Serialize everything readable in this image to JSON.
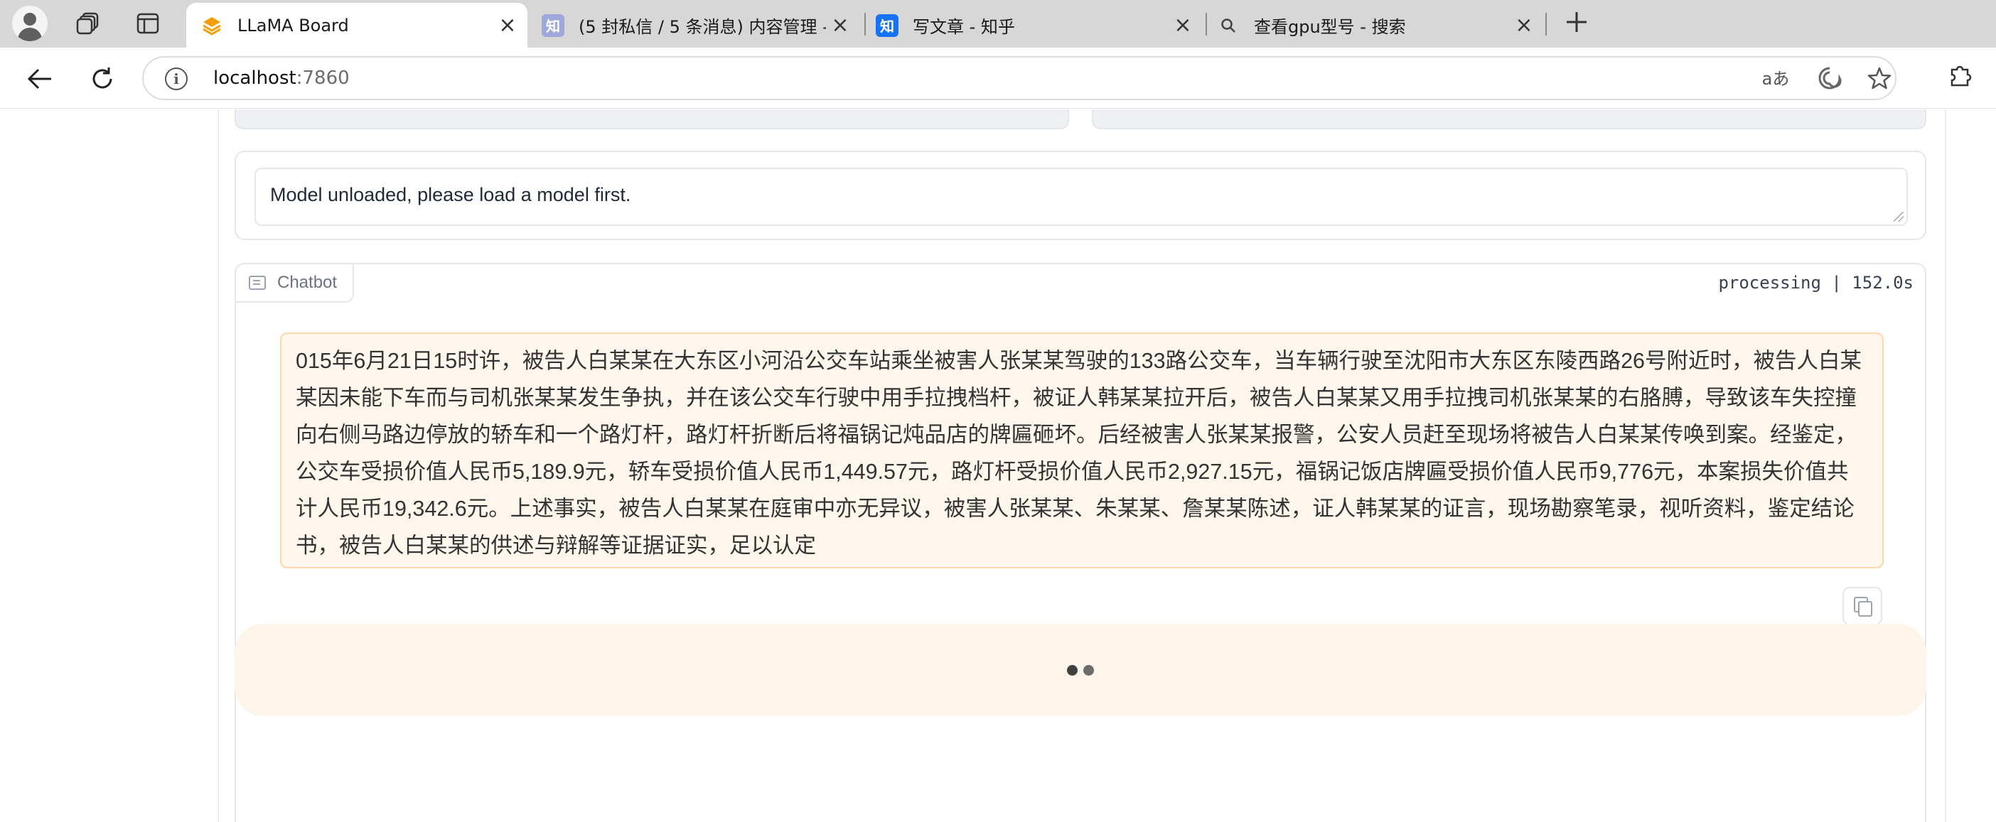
{
  "browser": {
    "tabs": [
      {
        "title": "LLaMA Board",
        "favicon": "llama-board-icon",
        "active": true
      },
      {
        "title": "(5 封私信 / 5 条消息) 内容管理 - 知乎",
        "favicon": "zhihu-icon",
        "active": false
      },
      {
        "title": "写文章 - 知乎",
        "favicon": "zhihu-icon",
        "active": false
      },
      {
        "title": "查看gpu型号 - 搜索",
        "favicon": "search-icon",
        "active": false
      }
    ],
    "address": {
      "host": "localhost",
      "port": ":7860"
    }
  },
  "info_box": {
    "message": "Model unloaded, please load a model first."
  },
  "chatbot": {
    "label": "Chatbot",
    "status": "processing | 152.0s",
    "messages": [
      {
        "role": "user",
        "text": "015年6月21日15时许，被告人白某某在大东区小河沿公交车站乘坐被害人张某某驾驶的133路公交车，当车辆行驶至沈阳市大东区东陵西路26号附近时，被告人白某某因未能下车而与司机张某某发生争执，并在该公交车行驶中用手拉拽档杆，被证人韩某某拉开后，被告人白某某又用手拉拽司机张某某的右胳膊，导致该车失控撞向右侧马路边停放的轿车和一个路灯杆，路灯杆折断后将福锅记炖品店的牌匾砸坏。后经被害人张某某报警，公安人员赶至现场将被告人白某某传唤到案。经鉴定，公交车受损价值人民币5,189.9元，轿车受损价值人民币1,449.57元，路灯杆受损价值人民币2,927.15元，福锅记饭店牌匾受损价值人民币9,776元，本案损失价值共计人民币19,342.6元。上述事实，被告人白某某在庭审中亦无异议，被害人张某某、朱某某、詹某某陈述，证人韩某某的证言，现场勘察笔录，视听资料，鉴定结论书，被告人白某某的供述与辩解等证据证实，足以认定"
      },
      {
        "role": "assistant",
        "text": "",
        "loading": true
      }
    ]
  },
  "colors": {
    "user_bubble_bg": "#fff7ed",
    "user_bubble_border": "#fed7aa",
    "bot_bubble_bg": "#fdf5ea"
  }
}
